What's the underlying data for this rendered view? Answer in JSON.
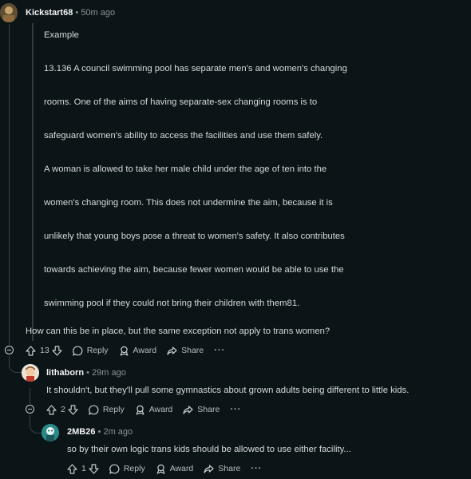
{
  "comments": [
    {
      "user": "Kickstart68",
      "time": "50m ago",
      "quote_lines": [
        "Example",
        "13.136 A council swimming pool has separate men's and women's changing",
        "rooms. One of the aims of having separate-sex changing rooms is to",
        "safeguard women's ability to access the facilities and use them safely.",
        "A woman is allowed to take her male child under the age of ten into the",
        "women's changing room. This does not undermine the aim, because it is",
        "unlikely that young boys pose a threat to women's safety. It also contributes",
        "towards achieving the aim, because fewer women would be able to use the",
        "swimming pool if they could not bring their children with them81."
      ],
      "body": "How can this be in place, but the same exception not apply to trans women?",
      "votes": "13",
      "reply_label": "Reply",
      "award_label": "Award",
      "share_label": "Share",
      "more_label": "···"
    },
    {
      "user": "lithaborn",
      "time": "29m ago",
      "body": "It shouldn't, but they'll pull some gymnastics about grown adults being different to little kids.",
      "votes": "2",
      "reply_label": "Reply",
      "award_label": "Award",
      "share_label": "Share",
      "more_label": "···"
    },
    {
      "user": "2MB26",
      "time": "2m ago",
      "body": "so by their own logic trans kids should be allowed to use either facility...",
      "votes": "1",
      "reply_label": "Reply",
      "award_label": "Award",
      "share_label": "Share",
      "more_label": "···"
    }
  ],
  "separator": "•",
  "colors": {
    "background": "#0b1416",
    "text": "#d7dadc",
    "muted": "#8a9296",
    "thread_line": "#3a3f42"
  },
  "icons": [
    "upvote-icon",
    "downvote-icon",
    "comment-icon",
    "award-icon",
    "share-icon",
    "collapse-icon"
  ]
}
